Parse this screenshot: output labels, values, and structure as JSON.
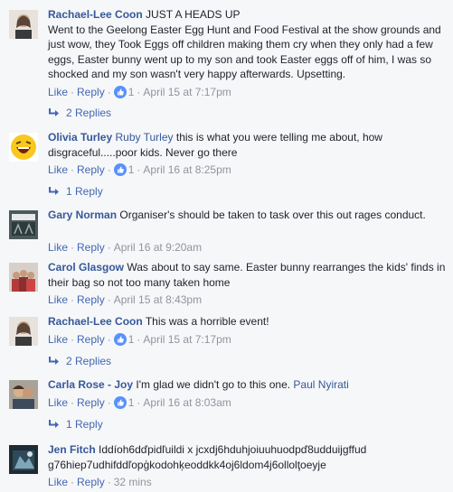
{
  "comments": [
    {
      "author": "Rachael-Lee Coon",
      "mention": "",
      "text": "JUST A HEADS UP\nWent to the Geelong Easter Egg Hunt and Food Festival at the show grounds and just wow, they Took Eggs off children making them cry when they only had a few eggs, Easter bunny went up to my son and took Easter eggs off of him, I was so shocked and my son wasn't very happy afterwards. Upsetting.",
      "like": "Like",
      "reply": "Reply",
      "reactions": "1",
      "time": "April 15 at 7:17pm",
      "replies": "2 Replies"
    },
    {
      "author": "Olivia Turley",
      "mention": "Ruby Turley",
      "text": "this is what you were telling me about, how disgraceful.....poor kids. Never go there",
      "like": "Like",
      "reply": "Reply",
      "reactions": "1",
      "time": "April 16 at 8:25pm",
      "replies": "1 Reply"
    },
    {
      "author": "Gary Norman",
      "mention": "",
      "text": "Organiser's should be taken to task over this out rages conduct.",
      "like": "Like",
      "reply": "Reply",
      "reactions": "",
      "time": "April 16 at 9:20am",
      "replies": ""
    },
    {
      "author": "Carol Glasgow",
      "mention": "",
      "text": "Was about to say same. Easter bunny rearranges the kids' finds in their bag so not too many taken home",
      "like": "Like",
      "reply": "Reply",
      "reactions": "",
      "time": "April 15 at 8:43pm",
      "replies": ""
    },
    {
      "author": "Rachael-Lee Coon",
      "mention": "",
      "text": "This was a horrible event!",
      "like": "Like",
      "reply": "Reply",
      "reactions": "1",
      "time": "April 15 at 7:17pm",
      "replies": "2 Replies"
    },
    {
      "author": "Carla Rose - Joy",
      "mention": "",
      "text": "I'm glad we didn't go to this one.",
      "mention_after": "Paul Nyirati",
      "like": "Like",
      "reply": "Reply",
      "reactions": "1",
      "time": "April 16 at 8:03am",
      "replies": "1 Reply"
    },
    {
      "author": "Jen Fitch",
      "mention": "",
      "text": "Iddíoh6dďpidľuildi x jcxdj6hduhjoiuuhuodpď8udduijgffud g76hiep7udhifddľopģkodohķeoddkk4oj6ldom4j6ollolţoeyje",
      "like": "Like",
      "reply": "Reply",
      "reactions": "",
      "time": "32 mins",
      "replies": ""
    }
  ],
  "colors": {
    "link": "#365899",
    "action": "#4267b2",
    "meta": "#90949c",
    "text": "#1d2129",
    "like_badge": "#5890ff"
  },
  "icons": {
    "reaction": "thumbs-up-icon",
    "reply_arrow": "reply-arrow-icon"
  }
}
